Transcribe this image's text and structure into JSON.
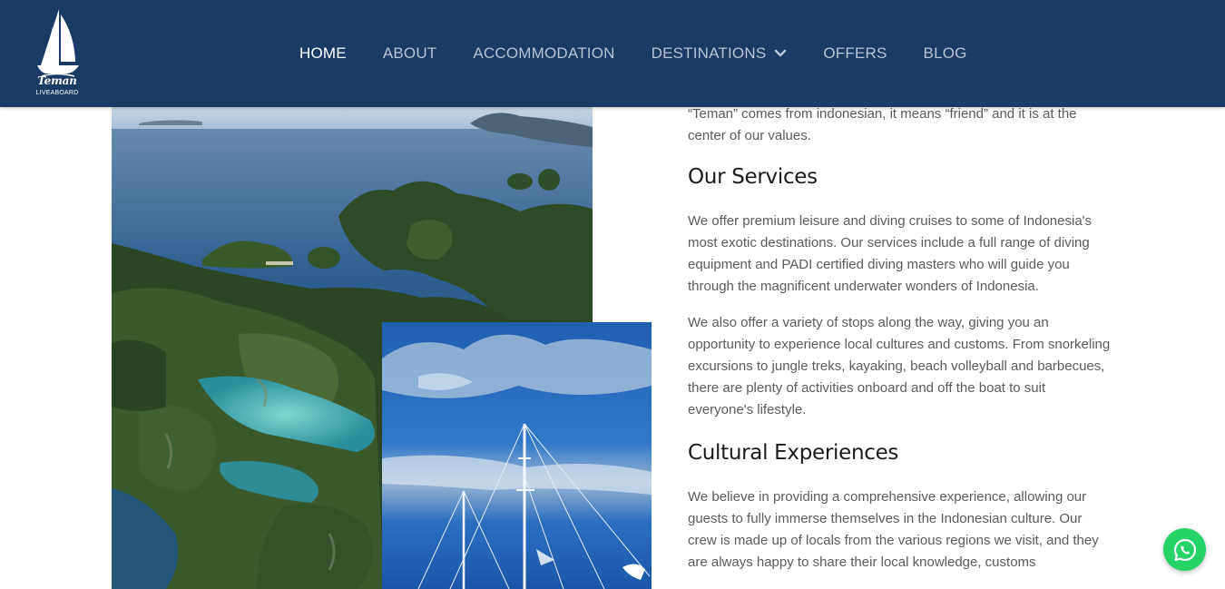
{
  "brand": {
    "name": "Teman",
    "tagline": "LIVEABOARD"
  },
  "nav": {
    "items": [
      {
        "label": "HOME",
        "active": true
      },
      {
        "label": "ABOUT"
      },
      {
        "label": "ACCOMMODATION"
      },
      {
        "label": "DESTINATIONS",
        "has_dropdown": true
      },
      {
        "label": "OFFERS"
      },
      {
        "label": "BLOG"
      }
    ]
  },
  "content": {
    "intro": "“Teman” comes from indonesian, it means “friend” and it is at the center of our values.",
    "services_heading": "Our Services",
    "services_p1": "We offer premium leisure and diving cruises to some of Indonesia's most exotic destinations. Our services include a full range of diving equipment and PADI certified diving masters who will guide you through the magnificent underwater wonders of Indonesia.",
    "services_p2": "We also offer a variety of stops along the way, giving you an opportunity to experience local cultures and customs. From snorkeling excursions to jungle treks, kayaking, beach volleyball and barbecues, there are plenty of activities onboard and off the boat to suit everyone's lifestyle.",
    "culture_heading": "Cultural Experiences",
    "culture_p1": "We believe in providing a comprehensive experience, allowing our guests to fully immerse themselves in the Indonesian culture. Our crew is made up of locals from the various regions we visit, and they are always happy to share their local knowledge, customs"
  },
  "icons": {
    "logo": "sailboat-logo-icon",
    "dropdown": "chevron-down-icon",
    "whatsapp": "whatsapp-icon"
  },
  "colors": {
    "header_bg": "#1b3a66",
    "nav_text": "#b9c3d3",
    "nav_active": "#ffffff",
    "body_text": "#5b5b5b",
    "heading_text": "#1a1a1a",
    "whatsapp": "#25d366"
  }
}
